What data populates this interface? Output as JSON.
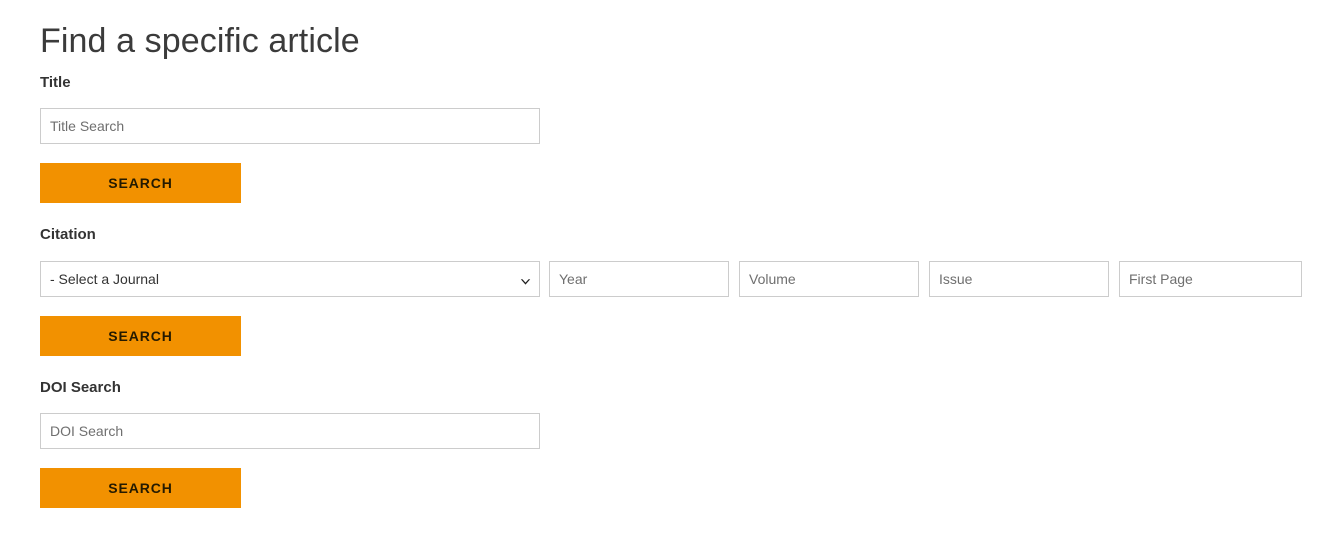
{
  "page": {
    "heading": "Find a specific article"
  },
  "title_search": {
    "label": "Title",
    "input_placeholder": "Title Search",
    "input_value": "",
    "button_label": "SEARCH"
  },
  "citation_search": {
    "label": "Citation",
    "journal_selected": "- Select a Journal",
    "journal_options": [
      "- Select a Journal"
    ],
    "year_placeholder": "Year",
    "year_value": "",
    "volume_placeholder": "Volume",
    "volume_value": "",
    "issue_placeholder": "Issue",
    "issue_value": "",
    "first_page_placeholder": "First Page",
    "first_page_value": "",
    "button_label": "SEARCH"
  },
  "doi_search": {
    "label": "DOI Search",
    "input_placeholder": "DOI Search",
    "input_value": "",
    "button_label": "SEARCH"
  },
  "colors": {
    "button_background": "#f29100",
    "button_text": "#241a00",
    "input_border": "#cccccc",
    "heading_text": "#3b3b3b",
    "label_text": "#333333",
    "placeholder_text": "#6f6f6f",
    "page_background": "#ffffff"
  },
  "icons": {
    "chevron_down": "chevron-down-icon"
  }
}
